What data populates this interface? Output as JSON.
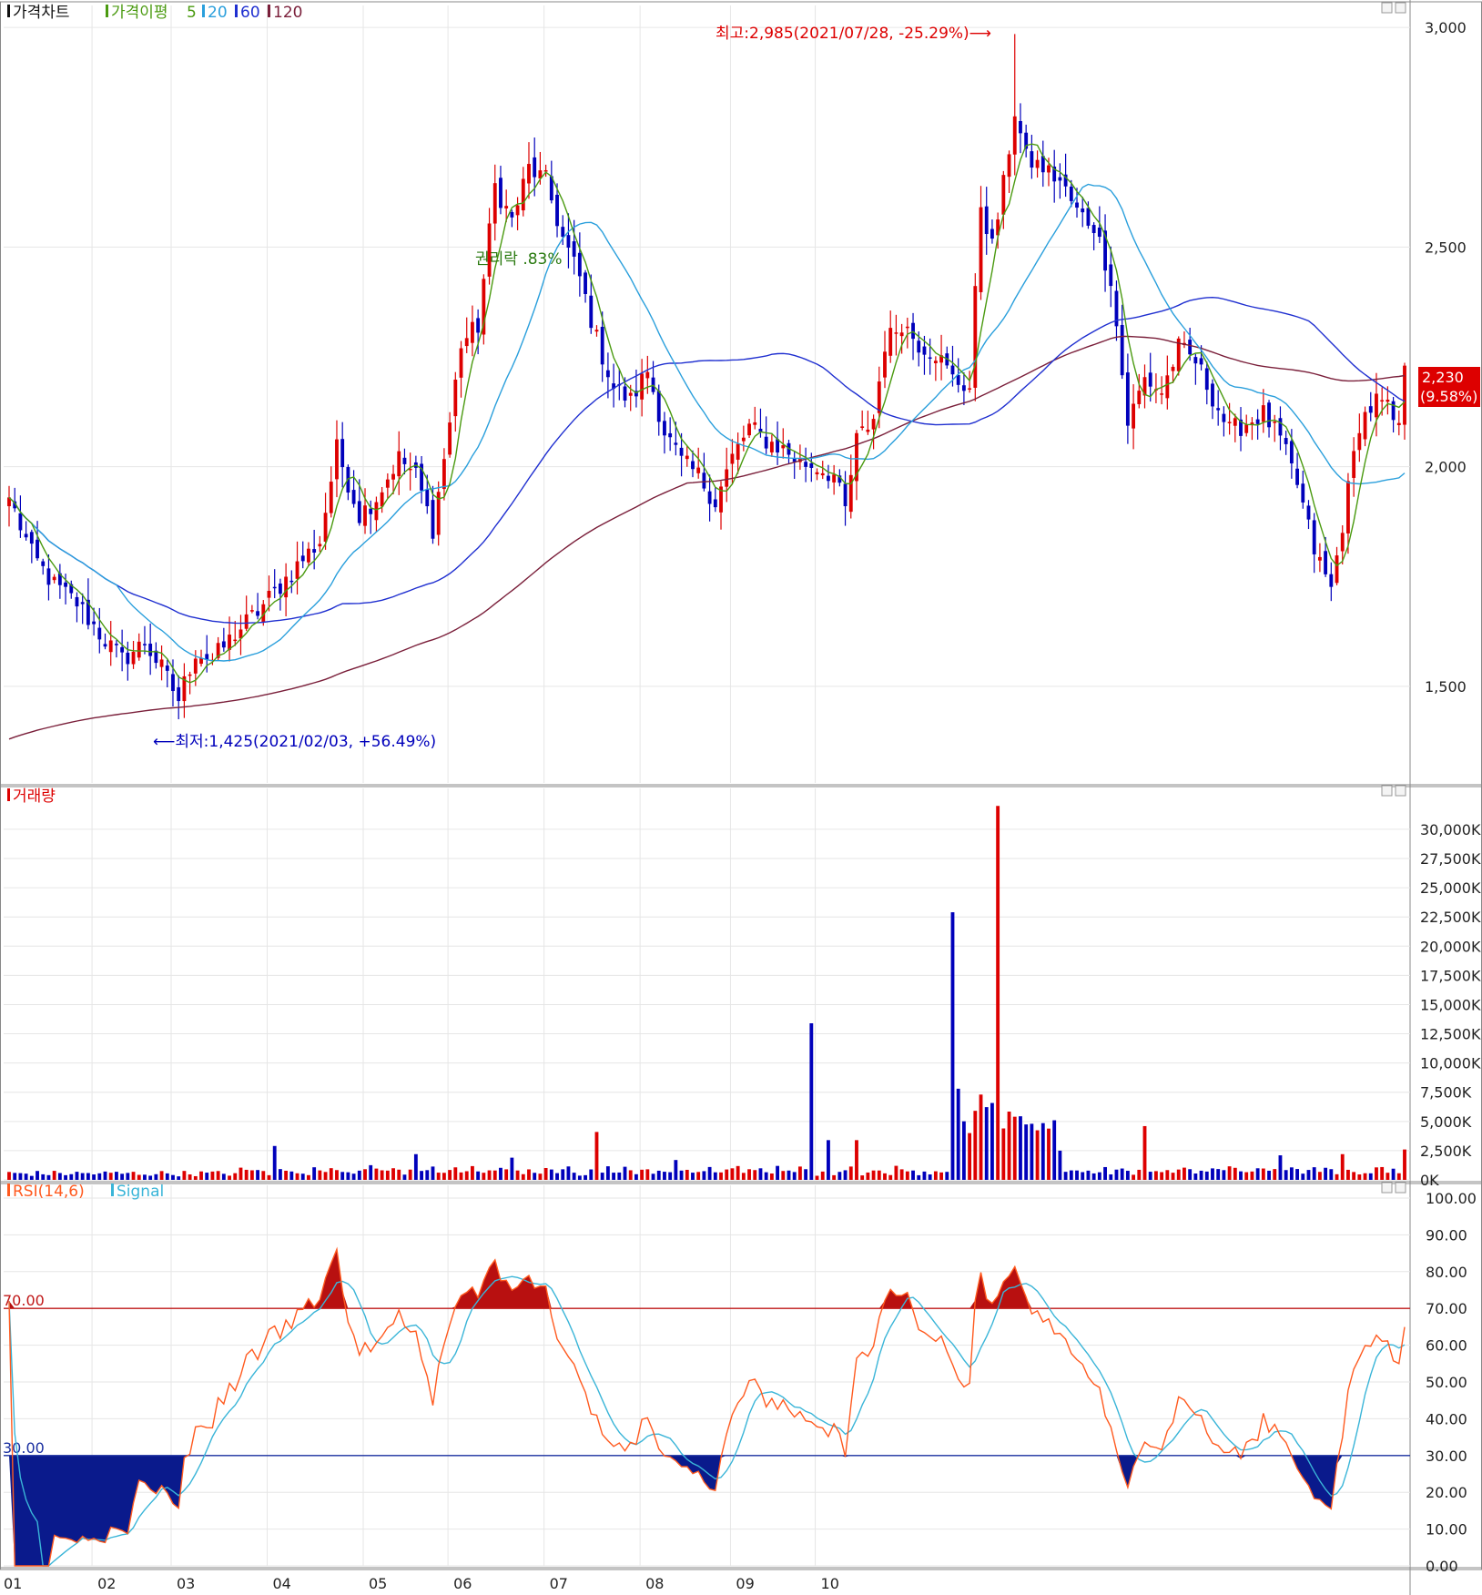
{
  "colors": {
    "up": "#dd0000",
    "down": "#0000bb",
    "ma5": "#4a9a10",
    "ma20": "#2a9fdc",
    "ma60": "#1f2fd0",
    "ma120": "#7a1f3a",
    "rsi": "#ff5a1f",
    "signal": "#3ab5d8",
    "upper_line": "#c01818",
    "lower_line": "#1a2fa0",
    "grid": "#e6e6e6",
    "frame": "#888888"
  },
  "legend_price": {
    "title": "가격차트",
    "envelope": "가격이평",
    "ma5": "5",
    "ma20": "20",
    "ma60": "60",
    "ma120": "120"
  },
  "legend_volume": {
    "title": "거래량"
  },
  "legend_rsi": {
    "title": "RSI(14,6)",
    "signal": "Signal"
  },
  "annotations": {
    "high": "최고:2,985(2021/07/28, -25.29%)⟶",
    "low": "⟵최저:1,425(2021/02/03, +56.49%)",
    "rights": "권리락 .83%",
    "current_price": "2,230",
    "current_change": "(9.58%)",
    "rsi_upper": "70.00",
    "rsi_lower": "30.00"
  },
  "chart_data": [
    {
      "type": "candlestick",
      "months": [
        "01",
        "02",
        "03",
        "04",
        "05",
        "06",
        "07",
        "08",
        "09",
        "10"
      ],
      "yticks": [
        "3,000",
        "2,500",
        "2,000",
        "1,500"
      ],
      "ylim": [
        1280,
        3050
      ],
      "ytick_values": [
        3000,
        2500,
        2000,
        1500
      ],
      "high": {
        "value": 2985,
        "date": "2021/07/28"
      },
      "low": {
        "value": 1425,
        "date": "2021/02/03"
      },
      "last_close": 2230,
      "anchors_close": [
        [
          0,
          1930
        ],
        [
          4,
          1800
        ],
        [
          8,
          1730
        ],
        [
          12,
          1690
        ],
        [
          16,
          1620
        ],
        [
          20,
          1560
        ],
        [
          24,
          1600
        ],
        [
          27,
          1540
        ],
        [
          30,
          1470
        ],
        [
          33,
          1580
        ],
        [
          36,
          1560
        ],
        [
          40,
          1620
        ],
        [
          44,
          1670
        ],
        [
          48,
          1730
        ],
        [
          52,
          1790
        ],
        [
          55,
          1830
        ],
        [
          58,
          2040
        ],
        [
          62,
          1890
        ],
        [
          65,
          1930
        ],
        [
          69,
          2020
        ],
        [
          72,
          1980
        ],
        [
          75,
          1860
        ],
        [
          78,
          2100
        ],
        [
          80,
          2280
        ],
        [
          83,
          2320
        ],
        [
          86,
          2640
        ],
        [
          89,
          2560
        ],
        [
          92,
          2680
        ],
        [
          95,
          2650
        ],
        [
          98,
          2520
        ],
        [
          101,
          2430
        ],
        [
          104,
          2290
        ],
        [
          107,
          2180
        ],
        [
          110,
          2150
        ],
        [
          113,
          2220
        ],
        [
          116,
          2080
        ],
        [
          119,
          2010
        ],
        [
          122,
          1980
        ],
        [
          125,
          1920
        ],
        [
          128,
          2020
        ],
        [
          131,
          2090
        ],
        [
          134,
          2060
        ],
        [
          137,
          2040
        ],
        [
          140,
          2010
        ],
        [
          143,
          2000
        ],
        [
          146,
          1980
        ],
        [
          148,
          1900
        ],
        [
          150,
          2060
        ],
        [
          153,
          2110
        ],
        [
          155,
          2280
        ],
        [
          158,
          2330
        ],
        [
          161,
          2280
        ],
        [
          164,
          2260
        ],
        [
          167,
          2200
        ],
        [
          170,
          2180
        ],
        [
          172,
          2600
        ],
        [
          174,
          2500
        ],
        [
          176,
          2640
        ],
        [
          178,
          2810
        ],
        [
          180,
          2700
        ],
        [
          183,
          2680
        ],
        [
          186,
          2650
        ],
        [
          189,
          2580
        ],
        [
          192,
          2550
        ],
        [
          195,
          2430
        ],
        [
          198,
          2100
        ],
        [
          201,
          2200
        ],
        [
          204,
          2170
        ],
        [
          207,
          2270
        ],
        [
          210,
          2240
        ],
        [
          213,
          2160
        ],
        [
          216,
          2080
        ],
        [
          219,
          2100
        ],
        [
          222,
          2120
        ],
        [
          225,
          2060
        ],
        [
          228,
          1960
        ],
        [
          231,
          1810
        ],
        [
          234,
          1720
        ],
        [
          236,
          1870
        ],
        [
          239,
          2100
        ],
        [
          242,
          2150
        ],
        [
          244,
          2130
        ],
        [
          246,
          2080
        ],
        [
          247,
          2230
        ]
      ],
      "ma_series": [
        "5",
        "20",
        "60",
        "120"
      ]
    },
    {
      "type": "bar",
      "title": "거래량",
      "yticks": [
        "30,000K",
        "27,500K",
        "25,000K",
        "22,500K",
        "20,000K",
        "17,500K",
        "15,000K",
        "12,500K",
        "10,000K",
        "7,500K",
        "5,000K",
        "2,500K",
        "0K"
      ],
      "ytick_values": [
        30000,
        27500,
        25000,
        22500,
        20000,
        17500,
        15000,
        12500,
        10000,
        7500,
        5000,
        2500,
        0
      ],
      "ylim": [
        0,
        33500
      ],
      "spikes": [
        [
          47,
          2900
        ],
        [
          72,
          2200
        ],
        [
          89,
          1900
        ],
        [
          104,
          4100
        ],
        [
          118,
          1700
        ],
        [
          142,
          13400
        ],
        [
          145,
          3400
        ],
        [
          150,
          3400
        ],
        [
          167,
          22900
        ],
        [
          168,
          7800
        ],
        [
          172,
          7300
        ],
        [
          175,
          32000
        ],
        [
          176,
          4400
        ],
        [
          181,
          4800
        ],
        [
          186,
          2500
        ],
        [
          201,
          4600
        ],
        [
          225,
          2100
        ],
        [
          236,
          2200
        ],
        [
          247,
          2600
        ]
      ]
    },
    {
      "type": "line",
      "title": "RSI(14,6)",
      "series": [
        {
          "name": "RSI(14,6)"
        },
        {
          "name": "Signal"
        }
      ],
      "yticks": [
        "100.00",
        "90.00",
        "80.00",
        "70.00",
        "60.00",
        "50.00",
        "40.00",
        "30.00",
        "20.00",
        "10.00",
        "0.00"
      ],
      "ytick_values": [
        100,
        90,
        80,
        70,
        60,
        50,
        40,
        30,
        20,
        10,
        0
      ],
      "ylim": [
        0,
        100
      ],
      "upper": 70,
      "lower": 30
    }
  ]
}
